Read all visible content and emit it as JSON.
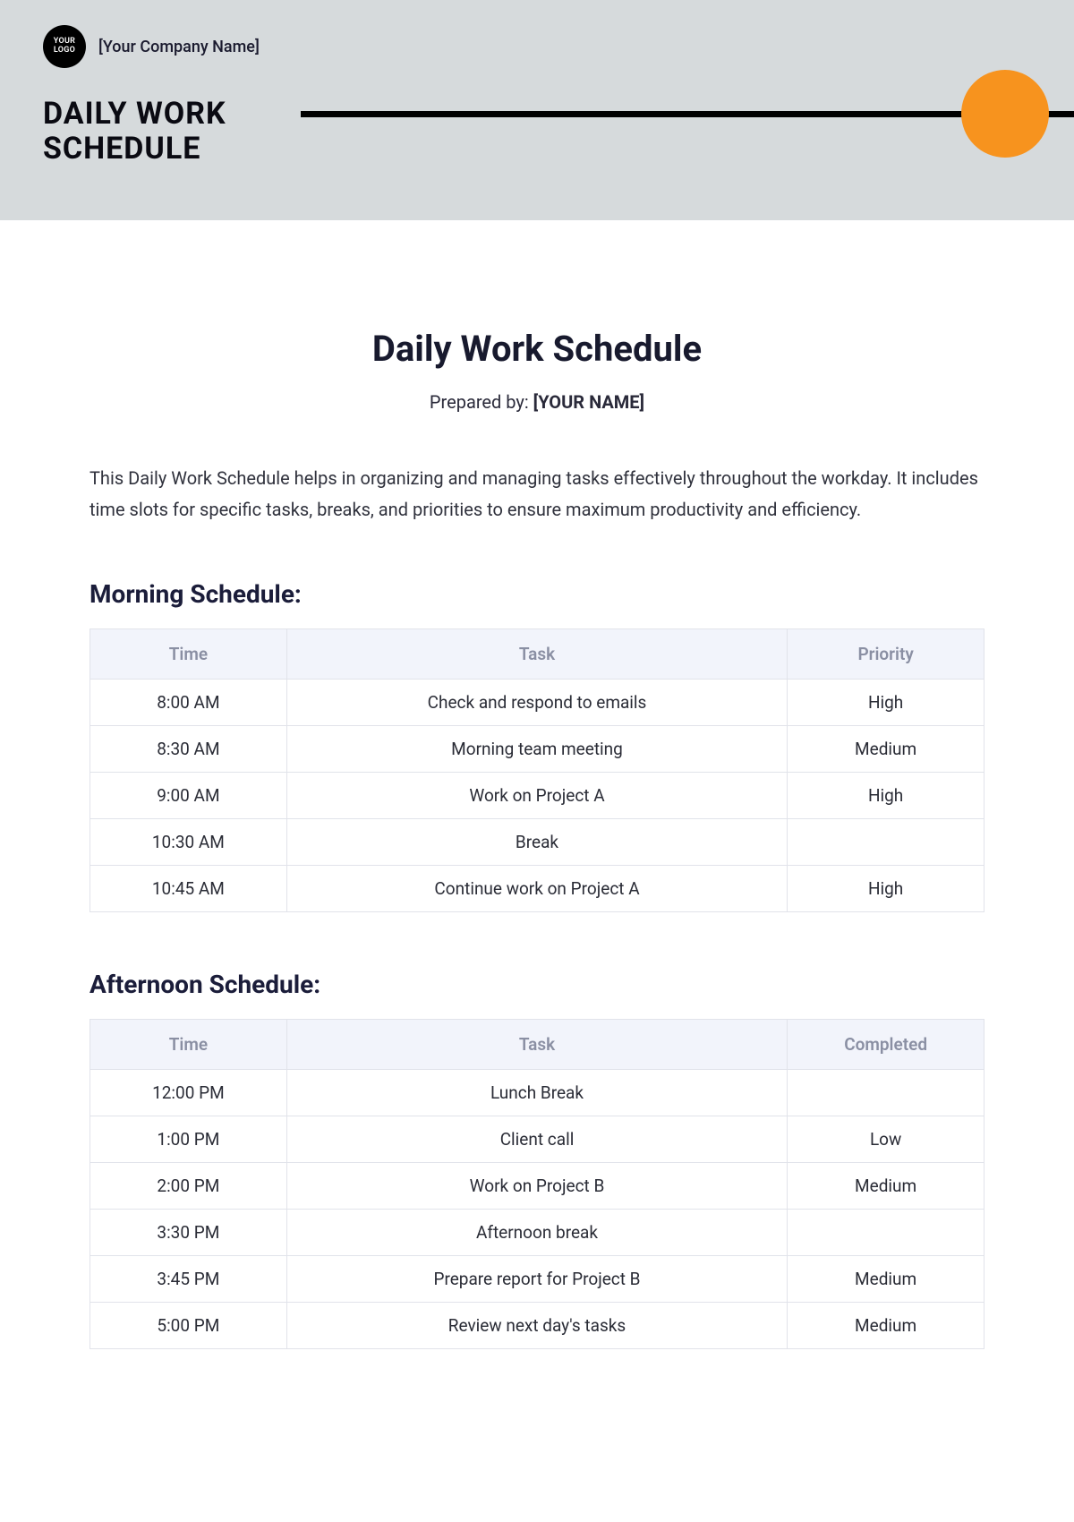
{
  "brand": {
    "logo_text": "YOUR LOGO",
    "company_placeholder": "[Your Company Name]"
  },
  "banner": {
    "title": "DAILY WORK SCHEDULE"
  },
  "doc": {
    "title": "Daily Work Schedule",
    "prepared_by_label": "Prepared by: ",
    "prepared_by_value": "[YOUR NAME]",
    "intro": "This Daily Work Schedule helps in organizing and managing tasks effectively throughout the workday. It includes time slots for specific tasks, breaks, and priorities to ensure maximum productivity and efficiency."
  },
  "morning": {
    "heading": "Morning Schedule:",
    "columns": [
      "Time",
      "Task",
      "Priority"
    ],
    "rows": [
      {
        "time": "8:00 AM",
        "task": "Check and respond to emails",
        "priority": "High"
      },
      {
        "time": "8:30 AM",
        "task": "Morning team meeting",
        "priority": "Medium"
      },
      {
        "time": "9:00 AM",
        "task": "Work on Project A",
        "priority": "High"
      },
      {
        "time": "10:30 AM",
        "task": "Break",
        "priority": ""
      },
      {
        "time": "10:45 AM",
        "task": "Continue work on Project A",
        "priority": "High"
      }
    ]
  },
  "afternoon": {
    "heading": "Afternoon Schedule:",
    "columns": [
      "Time",
      "Task",
      "Completed"
    ],
    "rows": [
      {
        "time": "12:00 PM",
        "task": "Lunch Break",
        "completed": ""
      },
      {
        "time": "1:00 PM",
        "task": "Client call",
        "completed": "Low"
      },
      {
        "time": "2:00 PM",
        "task": "Work on Project B",
        "completed": "Medium"
      },
      {
        "time": "3:30 PM",
        "task": "Afternoon break",
        "completed": ""
      },
      {
        "time": "3:45 PM",
        "task": "Prepare report for Project B",
        "completed": "Medium"
      },
      {
        "time": "5:00 PM",
        "task": "Review next day's tasks",
        "completed": "Medium"
      }
    ]
  }
}
